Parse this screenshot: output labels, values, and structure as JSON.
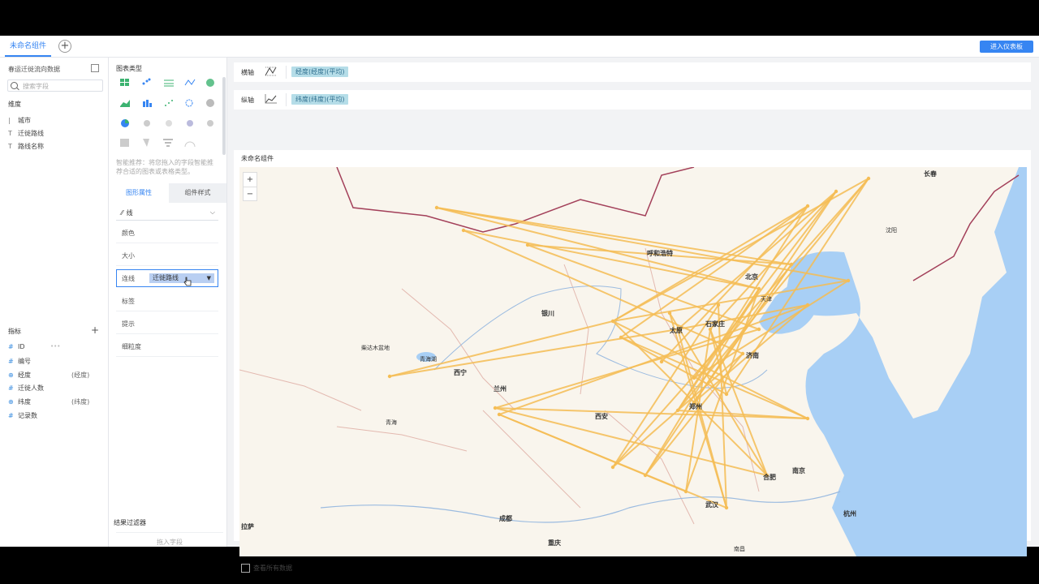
{
  "topbar": {
    "tab_label": "未命名组件",
    "add_tab_symbol": "+",
    "enter_dashboard": "进入仪表板"
  },
  "data_panel": {
    "dataset_name": "春运迁徙流向数据",
    "search_placeholder": "搜索字段",
    "dimension_title": "维度",
    "dimensions": [
      {
        "icon": "text-field-icon",
        "label": "城市"
      },
      {
        "icon": "text-field-icon",
        "label": "迁徙路线"
      },
      {
        "icon": "text-field-icon",
        "label": "路线名称"
      }
    ],
    "measure_title": "指标",
    "add_symbol": "+",
    "measures": [
      {
        "icon": "#",
        "label": "ID",
        "tag": ""
      },
      {
        "icon": "#",
        "label": "编号",
        "tag": ""
      },
      {
        "icon": "globe",
        "label": "经度",
        "tag": "(经度)"
      },
      {
        "icon": "#",
        "label": "迁徙人数",
        "tag": ""
      },
      {
        "icon": "globe",
        "label": "纬度",
        "tag": "(纬度)"
      },
      {
        "icon": "#",
        "label": "记录数",
        "tag": ""
      }
    ]
  },
  "chart_panel": {
    "title": "图表类型",
    "hint": "智能推荐：将您拖入的字段智能推荐合适的图表或表格类型。",
    "tab_graph": "图形属性",
    "tab_style": "组件样式",
    "mark_type": "线",
    "properties": [
      "颜色",
      "大小",
      "标签",
      "提示",
      "细粒度"
    ],
    "active_property": {
      "label": "连线",
      "value": "迁徙路线"
    },
    "result_filter": "结果过滤器",
    "drop_hint": "拖入字段"
  },
  "axes": {
    "x_label": "横轴",
    "x_field": "经度(经度)(平均)",
    "y_label": "纵轴",
    "y_field": "纬度(纬度)(平均)"
  },
  "chart": {
    "component_title": "未命名组件",
    "zoom_in": "+",
    "zoom_out": "−",
    "view_all": "查看所有数据",
    "line_color": "#f5bd55"
  },
  "map_labels": [
    {
      "t": "长春",
      "big": false
    },
    {
      "t": "沈阳",
      "big": false
    },
    {
      "t": "北京",
      "big": true
    },
    {
      "t": "天津",
      "big": false
    },
    {
      "t": "呼和浩特",
      "big": true
    },
    {
      "t": "银川",
      "big": true
    },
    {
      "t": "太原",
      "big": true
    },
    {
      "t": "石家庄",
      "big": true
    },
    {
      "t": "济南",
      "big": true
    },
    {
      "t": "西宁",
      "big": true
    },
    {
      "t": "兰州",
      "big": true
    },
    {
      "t": "西安",
      "big": true
    },
    {
      "t": "郑州",
      "big": true
    },
    {
      "t": "合肥",
      "big": true
    },
    {
      "t": "南京",
      "big": true
    },
    {
      "t": "武汉",
      "big": true
    },
    {
      "t": "成都",
      "big": true
    },
    {
      "t": "重庆",
      "big": true
    },
    {
      "t": "杭州",
      "big": true
    },
    {
      "t": "拉萨",
      "big": true
    },
    {
      "t": "南昌",
      "big": false
    },
    {
      "t": "青海湖",
      "big": false
    },
    {
      "t": "柴达木盆地",
      "big": false
    },
    {
      "t": "青海",
      "big": false
    }
  ]
}
